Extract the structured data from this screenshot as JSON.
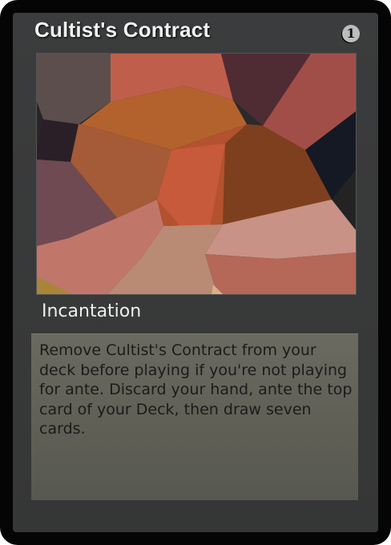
{
  "card": {
    "name": "Cultist's Contract",
    "mana_cost": "1",
    "type_line": "Incantation",
    "rules_text": "Remove Cultist's Contract from your deck before playing if you're not playing for ante. Discard your hand, ante the top card of your Deck, then draw seven cards."
  },
  "colors": {
    "frame": "#3a3b3c",
    "border": "#050505",
    "textbox": "#62625a",
    "title_text": "#f2f2f2"
  }
}
